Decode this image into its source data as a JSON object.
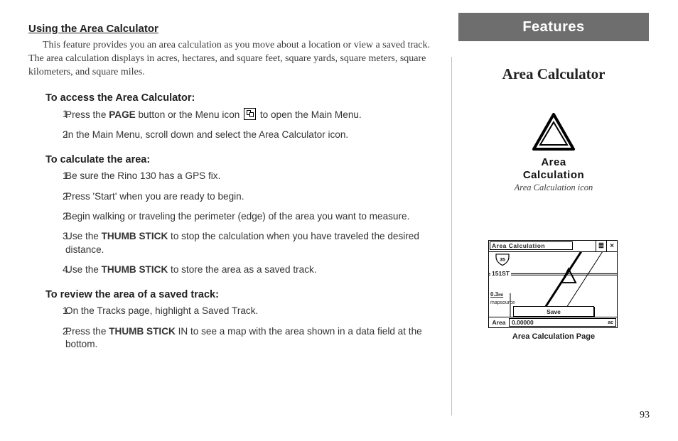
{
  "tab_label": "Features",
  "feature_title": "Area Calculator",
  "page_number": "93",
  "left": {
    "section_title": "Using the Area Calculator",
    "intro": "This feature provides you an area calculation as you move about a location or view a saved track.  The area calculation displays in acres, hectares, and square feet, square yards, square meters, square kilometers, and square miles.",
    "sub1": {
      "head": "To access the Area Calculator:",
      "s1_a": "Press the ",
      "s1_b": "PAGE",
      "s1_c": " button or the Menu icon ",
      "s1_d": " to open the Main Menu.",
      "s2": "In the Main Menu, scroll down and select the Area Calculator icon."
    },
    "sub2": {
      "head": "To calculate the area:",
      "steps": [
        {
          "n": "1.",
          "t": "Be sure the Rino 130 has a GPS fix."
        },
        {
          "n": "2.",
          "t": "Press 'Start' when you are ready to begin."
        },
        {
          "n": "2.",
          "t": "Begin walking or traveling the perimeter (edge) of the area you want to measure."
        },
        {
          "n": "3.",
          "t_a": "Use the ",
          "t_b": "THUMB STICK",
          "t_c": " to stop the calculation when you have traveled the desired distance."
        },
        {
          "n": "4.",
          "t_a": "Use the ",
          "t_b": "THUMB STICK",
          "t_c": " to store the area as a saved track."
        }
      ]
    },
    "sub3": {
      "head": "To review the area of a saved track:",
      "s1": "On the Tracks page, highlight a Saved Track.",
      "s2_a": "Press the ",
      "s2_b": "THUMB STICK",
      "s2_c": " IN to see a map with the area shown in a data field at the bottom."
    }
  },
  "right": {
    "icon_line1": "Area",
    "icon_line2": "Calculation",
    "icon_caption": "Area Calculation icon",
    "screen": {
      "title": "Area Calculation",
      "menu_glyph": "≣",
      "close_glyph": "×",
      "street": "151ST",
      "zoom": "0.3",
      "zoom_unit": "mi",
      "source": "mapsource",
      "save": "Save",
      "area_label": "Area",
      "area_value": "0.00000",
      "area_unit": "ac"
    },
    "screen_caption": "Area Calculation Page"
  }
}
